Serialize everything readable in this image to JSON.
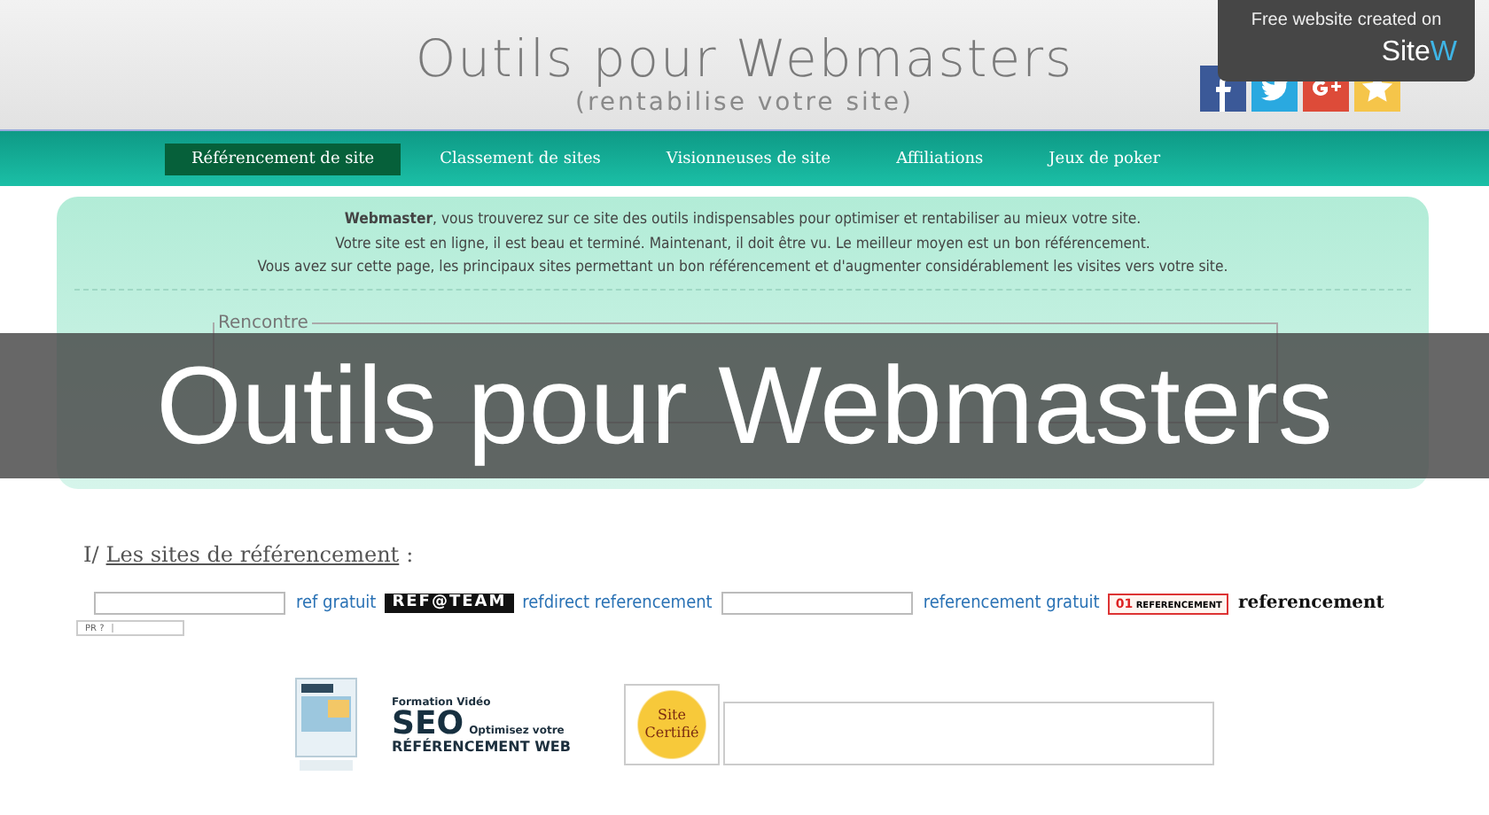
{
  "header": {
    "title": "Outils pour Webmasters",
    "subtitle": "(rentabilise votre site)"
  },
  "social": [
    {
      "kind": "facebook",
      "color": "#3b5998"
    },
    {
      "kind": "twitter",
      "color": "#2aa9e0"
    },
    {
      "kind": "google",
      "color": "#dd4b39"
    },
    {
      "kind": "star",
      "color": "#f5c54a"
    }
  ],
  "sitew": {
    "text": "Free website created on",
    "brand": "Site",
    "brand_accent": "W"
  },
  "nav": [
    {
      "label": "Référencement de site",
      "selected": true
    },
    {
      "label": "Classement de sites",
      "selected": false
    },
    {
      "label": "Visionneuses de site",
      "selected": false
    },
    {
      "label": "Affiliations",
      "selected": false
    },
    {
      "label": "Jeux de poker",
      "selected": false
    }
  ],
  "intro": [
    "**Webmaster**, vous trouverez sur ce site des outils indispensables pour optimiser et rentabiliser au mieux votre site.",
    "Votre site est en ligne, il est beau et terminé. Maintenant, il doit être vu. Le meilleur moyen est un bon référencement.",
    "Vous avez sur cette page, les principaux sites permettant un bon référencement et d'augmenter considérablement les visites vers votre site."
  ],
  "fieldset": {
    "legend": "Rencontre"
  },
  "overlay": {
    "title": "Outils pour Webmasters"
  },
  "section": {
    "number": "I/",
    "title": "Les sites de référencement",
    "suffix": ":"
  },
  "links": [
    {
      "kind": "field"
    },
    {
      "kind": "link",
      "text": "ref gratuit"
    },
    {
      "kind": "logo_dark",
      "text": "REF@TEAM"
    },
    {
      "kind": "link",
      "text": "refdirect referencement"
    },
    {
      "kind": "field"
    },
    {
      "kind": "link",
      "text": "referencement gratuit"
    },
    {
      "kind": "logo_red",
      "prefix": "01",
      "text": "REFERENCEMENT"
    },
    {
      "kind": "bold",
      "text": "referencement"
    }
  ],
  "pagerank": {
    "label": "PR ?"
  },
  "ad": {
    "caption": "Formation Vidéo",
    "big": "SEO",
    "tagline": "Optimisez votre",
    "line": "RÉFÉRENCEMENT WEB"
  },
  "badge": {
    "line1": "Site",
    "line2": "Certifié"
  }
}
